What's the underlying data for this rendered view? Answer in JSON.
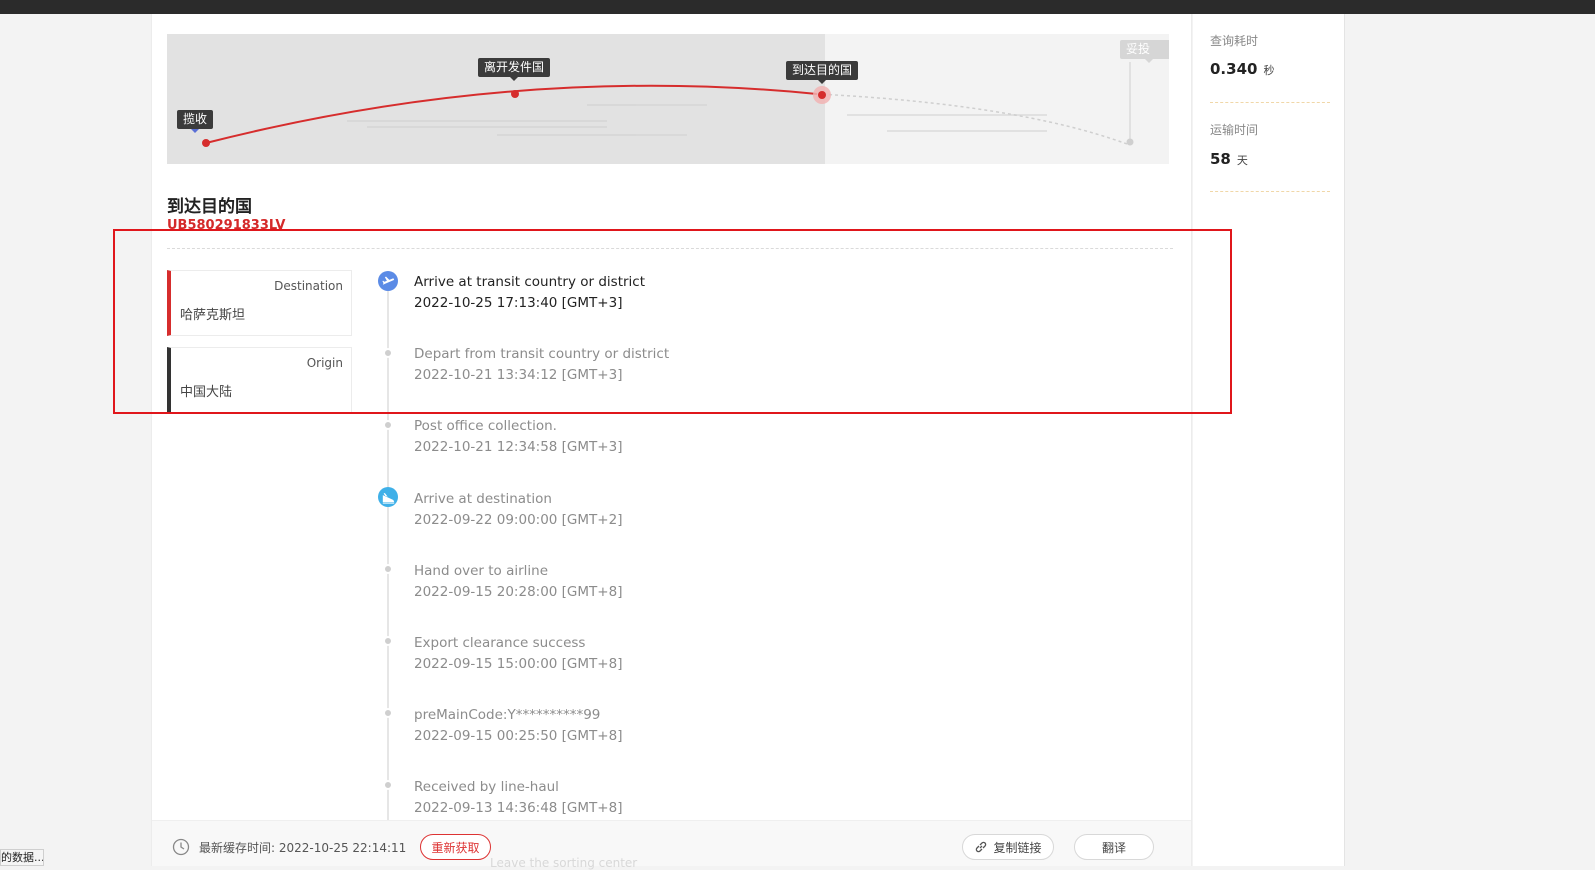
{
  "route_map": {
    "stages": [
      {
        "label": "揽收",
        "state": "done"
      },
      {
        "label": "离开发件国",
        "state": "done"
      },
      {
        "label": "到达目的国",
        "state": "current"
      },
      {
        "label": "妥投",
        "state": "pending"
      }
    ]
  },
  "status": {
    "title": "到达目的国",
    "tracking_number": "UB580291833LV"
  },
  "locations": {
    "destination": {
      "label": "Destination",
      "value": "哈萨克斯坦"
    },
    "origin": {
      "label": "Origin",
      "value": "中国大陆"
    }
  },
  "events": [
    {
      "desc": "Arrive at transit country or district",
      "time": "2022-10-25 17:13:40 [GMT+3]",
      "icon": "plane-takeoff-icon",
      "icon_color": "#5b8be6",
      "active": true
    },
    {
      "desc": "Depart from transit country or district",
      "time": "2022-10-21 13:34:12 [GMT+3]",
      "icon": "dot",
      "active": false
    },
    {
      "desc": "Post office collection.",
      "time": "2022-10-21 12:34:58 [GMT+3]",
      "icon": "dot",
      "active": false
    },
    {
      "desc": "Arrive at destination",
      "time": "2022-09-22 09:00:00 [GMT+2]",
      "icon": "plane-landing-icon",
      "icon_color": "#3fb0e8",
      "active": false
    },
    {
      "desc": "Hand over to airline",
      "time": "2022-09-15 20:28:00 [GMT+8]",
      "icon": "dot",
      "active": false
    },
    {
      "desc": "Export clearance success",
      "time": "2022-09-15 15:00:00 [GMT+8]",
      "icon": "dot",
      "active": false
    },
    {
      "desc": "preMainCode:Y**********99",
      "time": "2022-09-15 00:25:50 [GMT+8]",
      "icon": "dot",
      "active": false
    },
    {
      "desc": "Received by line-haul",
      "time": "2022-09-13 14:36:48 [GMT+8]",
      "icon": "dot",
      "active": false
    }
  ],
  "side_panel": {
    "query_time_label": "查询耗时",
    "query_time_value": "0.340",
    "query_time_unit": "秒",
    "transit_label": "运输时间",
    "transit_value": "58",
    "transit_unit": "天"
  },
  "bottom_bar": {
    "cache_time": "最新缓存时间: 2022-10-25 22:14:11",
    "refresh_label": "重新获取",
    "copy_link_label": "复制链接",
    "translate_label": "翻译",
    "ghost_text": "Leave the sorting center"
  },
  "browser_status": "的数据..."
}
